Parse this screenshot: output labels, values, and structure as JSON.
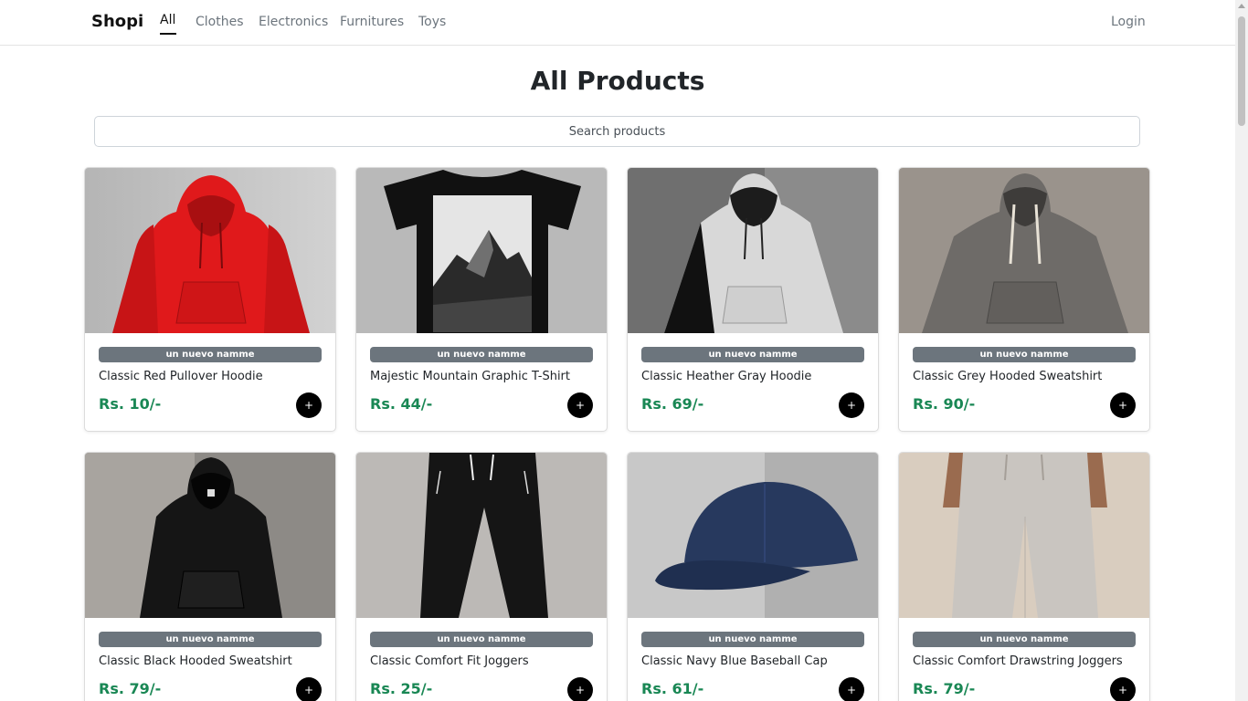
{
  "nav": {
    "brand": "Shopi",
    "links": [
      "All",
      "Clothes",
      "Electronics",
      "Furnitures",
      "Toys"
    ],
    "active": "All",
    "login": "Login"
  },
  "page": {
    "title": "All Products",
    "search_placeholder": "Search products"
  },
  "products": [
    {
      "category": "un nuevo namme",
      "name": "Classic Red Pullover Hoodie",
      "price": "Rs. 10/-",
      "add": "+",
      "image": "red-hoodie-photo"
    },
    {
      "category": "un nuevo namme",
      "name": "Majestic Mountain Graphic T-Shirt",
      "price": "Rs. 44/-",
      "add": "+",
      "image": "mountain-tshirt-photo"
    },
    {
      "category": "un nuevo namme",
      "name": "Classic Heather Gray Hoodie",
      "price": "Rs. 69/-",
      "add": "+",
      "image": "gray-hoodie-photo"
    },
    {
      "category": "un nuevo namme",
      "name": "Classic Grey Hooded Sweatshirt",
      "price": "Rs. 90/-",
      "add": "+",
      "image": "grey-sweatshirt-photo"
    },
    {
      "category": "un nuevo namme",
      "name": "Classic Black Hooded Sweatshirt",
      "price": "Rs. 79/-",
      "add": "+",
      "image": "black-hoodie-photo"
    },
    {
      "category": "un nuevo namme",
      "name": "Classic Comfort Fit Joggers",
      "price": "Rs. 25/-",
      "add": "+",
      "image": "black-joggers-photo"
    },
    {
      "category": "un nuevo namme",
      "name": "Classic Navy Blue Baseball Cap",
      "price": "Rs. 61/-",
      "add": "+",
      "image": "navy-cap-photo"
    },
    {
      "category": "un nuevo namme",
      "name": "Classic Comfort Drawstring Joggers",
      "price": "Rs. 79/-",
      "add": "+",
      "image": "beige-joggers-photo"
    }
  ],
  "colors": {
    "price": "#198754",
    "badge": "#6c757d",
    "add_button": "#000000"
  }
}
